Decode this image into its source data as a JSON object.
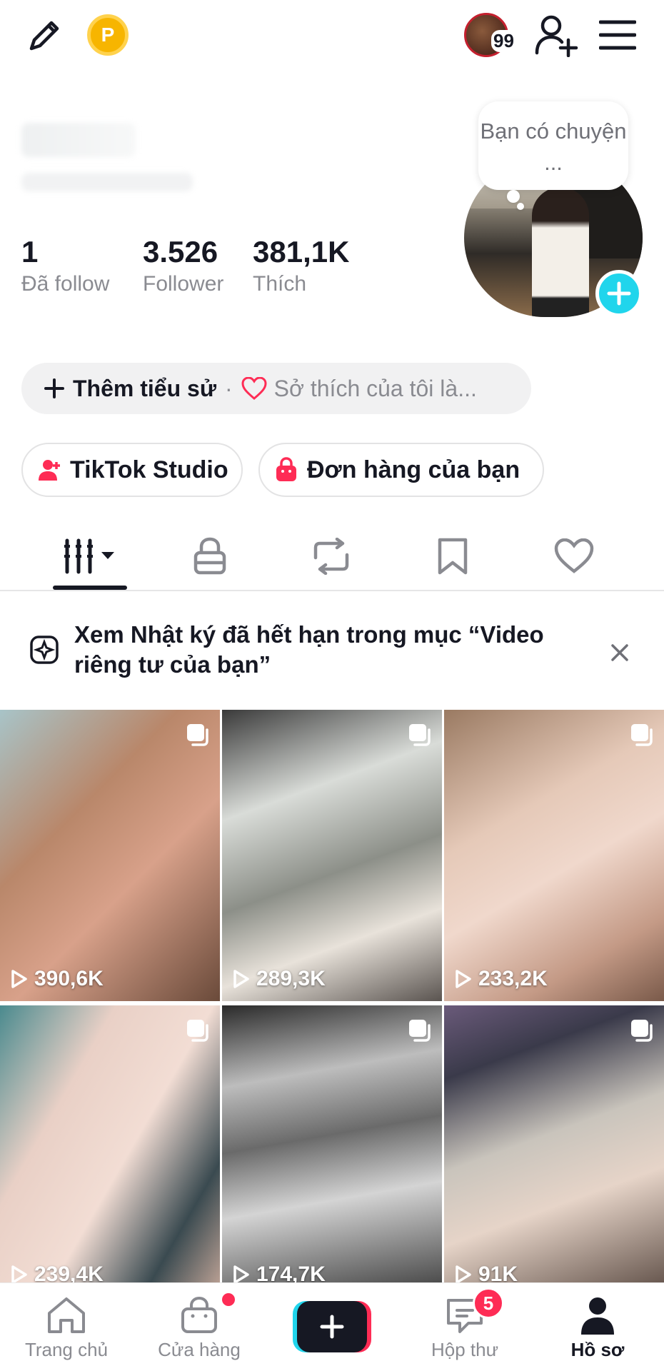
{
  "header": {
    "coin_label": "P",
    "story_count": "99"
  },
  "profile": {
    "stats": [
      {
        "value": "1",
        "label": "Đã follow"
      },
      {
        "value": "3.526",
        "label": "Follower"
      },
      {
        "value": "381,1K",
        "label": "Thích"
      }
    ],
    "bubble_text": "Bạn có chuyện ..."
  },
  "bio": {
    "add_label": "Thêm tiểu sử",
    "separator": "·",
    "hobby_hint": "Sở thích của tôi là..."
  },
  "actions": {
    "studio_label": "TikTok Studio",
    "orders_label": "Đơn hàng của bạn"
  },
  "tabs": [
    "videos-icon",
    "lock-icon",
    "repost-icon",
    "bookmark-icon",
    "heart-icon"
  ],
  "notice": {
    "text": "Xem Nhật ký đã hết hạn trong mục “Video riêng tư của bạn”"
  },
  "videos": [
    {
      "views": "390,6K"
    },
    {
      "views": "289,3K"
    },
    {
      "views": "233,2K"
    },
    {
      "views": "239,4K"
    },
    {
      "views": "174,7K"
    },
    {
      "views": "91K"
    }
  ],
  "nav": {
    "home": "Trang chủ",
    "shop": "Cửa hàng",
    "inbox": "Hộp thư",
    "inbox_badge": "5",
    "profile": "Hồ sơ"
  },
  "colors": {
    "accent_cyan": "#20d5ec",
    "accent_red": "#fe2c55",
    "text_primary": "#161823",
    "text_secondary": "#8a8b91"
  }
}
